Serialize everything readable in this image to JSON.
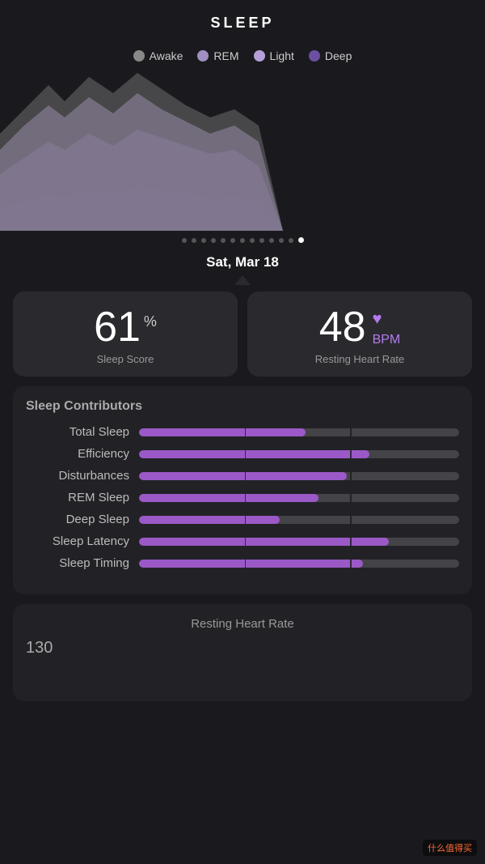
{
  "header": {
    "title": "SLEEP"
  },
  "legend": [
    {
      "label": "Awake",
      "color": "#888888"
    },
    {
      "label": "REM",
      "color": "#a08fc0"
    },
    {
      "label": "Light",
      "color": "#b59fd8"
    },
    {
      "label": "Deep",
      "color": "#6b4fa0"
    }
  ],
  "chart": {
    "pagination_dots": 13,
    "active_dot": 12
  },
  "date": {
    "text": "Sat, Mar 18"
  },
  "stats": {
    "sleep_score": {
      "value": "61",
      "unit": "%",
      "label": "Sleep Score"
    },
    "resting_heart_rate": {
      "value": "48",
      "unit": "BPM",
      "label": "Resting Heart Rate"
    }
  },
  "contributors": {
    "title": "Sleep Contributors",
    "items": [
      {
        "label": "Total Sleep",
        "fill_pct": 52
      },
      {
        "label": "Efficiency",
        "fill_pct": 72
      },
      {
        "label": "Disturbances",
        "fill_pct": 65
      },
      {
        "label": "REM Sleep",
        "fill_pct": 56
      },
      {
        "label": "Deep Sleep",
        "fill_pct": 44
      },
      {
        "label": "Sleep Latency",
        "fill_pct": 78
      },
      {
        "label": "Sleep Timing",
        "fill_pct": 70
      }
    ]
  },
  "heart_rate_chart": {
    "title": "Resting Heart Rate",
    "value": "130"
  },
  "watermark": "什么值得买"
}
